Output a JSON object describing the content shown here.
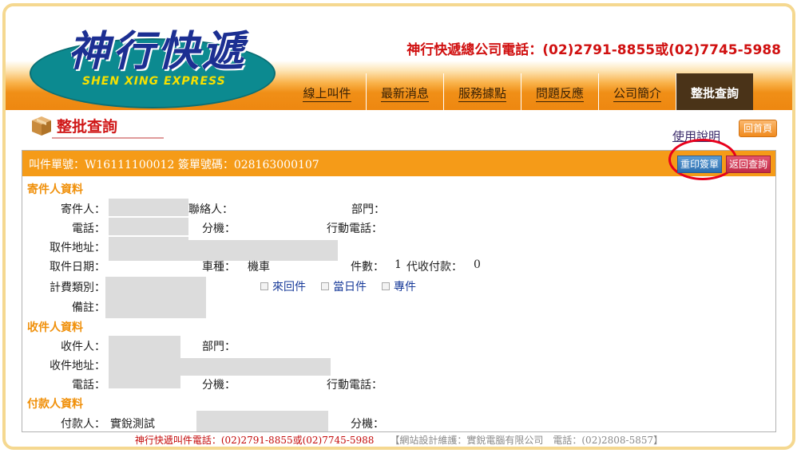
{
  "brand": {
    "name_cn": "神行快遞",
    "name_en": "SHEN XING EXPRESS",
    "hq_phone": "神行快遞總公司電話：(02)2791-8855或(02)7745-5988"
  },
  "nav": {
    "items": [
      {
        "label": "線上叫件",
        "active": false
      },
      {
        "label": "最新消息",
        "active": false
      },
      {
        "label": "服務據點",
        "active": false
      },
      {
        "label": "問題反應",
        "active": false
      },
      {
        "label": "公司簡介",
        "active": false
      },
      {
        "label": "整批查詢",
        "active": true
      }
    ]
  },
  "page": {
    "title": "整批查詢",
    "help_link": "使用說明",
    "home_button": "回首頁"
  },
  "order": {
    "header": "叫件單號：W16111100012   簽單號碼：028163000107",
    "reprint_button": "重印簽單",
    "back_button": "返回查詢"
  },
  "sender": {
    "section": "寄件人資料",
    "sender_label": "寄件人：",
    "contact_label": "聯絡人：",
    "dept_label": "部門：",
    "phone_label": "電話：",
    "ext_label": "分機：",
    "mobile_label": "行動電話：",
    "address_label": "取件地址：",
    "pickup_date_label": "取件日期：",
    "vehicle_label": "車種：",
    "vehicle_value": "機車",
    "pieces_label": "件數：",
    "pieces_value": "1",
    "cod_label": "代收付款：",
    "cod_value": "0",
    "fee_type_label": "計費類別：",
    "options": [
      "來回件",
      "當日件",
      "專件"
    ],
    "note_label": "備註："
  },
  "receiver": {
    "section": "收件人資料",
    "receiver_label": "收件人：",
    "dept_label": "部門：",
    "address_label": "收件地址：",
    "phone_label": "電話：",
    "ext_label": "分機：",
    "mobile_label": "行動電話："
  },
  "payer": {
    "section": "付款人資料",
    "payer_label": "付款人：",
    "payer_value": "實銳測試",
    "ext_label": "分機："
  },
  "footer": {
    "line1": "神行快遞叫件電話：(02)2791-8855或(02)7745-5988",
    "line2": "【網站設計維護：實銳電腦有限公司　電話：(02)2808-5857】"
  },
  "colors": {
    "accent_orange": "#f59b18",
    "title_red": "#d01818",
    "nav_active": "#4a3318"
  }
}
